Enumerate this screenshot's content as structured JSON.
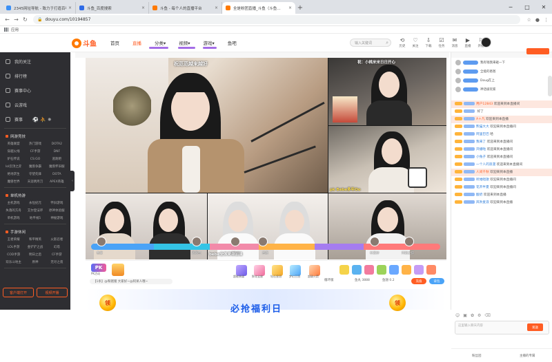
{
  "browser": {
    "tabs": [
      {
        "title": "2345网址导航 - 致力于打造百年品牌",
        "fav": "#3b8ff5",
        "active": false
      },
      {
        "title": "斗鱼_百度搜索",
        "fav": "#2f6be6",
        "active": false
      },
      {
        "title": "斗鱼 - 每个人的直播平台",
        "fav": "#ff7a00",
        "active": false
      },
      {
        "title": "全是粉团直播_斗鱼（斗鱼…",
        "fav": "#ff7a00",
        "active": true
      }
    ],
    "url": "douyu.com/10194857",
    "bookmarks_label": "应用",
    "new_tab_symbol": "+"
  },
  "site": {
    "logo": "斗鱼",
    "nav": [
      {
        "label": "首页",
        "active": false
      },
      {
        "label": "直播",
        "active": true
      },
      {
        "label": "分类▾",
        "active": false
      },
      {
        "label": "视频▾",
        "active": false
      },
      {
        "label": "游戏▾",
        "active": false
      },
      {
        "label": "鱼吧",
        "active": false
      }
    ],
    "search_placeholder": "输入关键词",
    "top_icons": [
      "历史",
      "关注",
      "下载",
      "任务",
      "消息",
      "直播",
      "开播"
    ]
  },
  "sidebar": {
    "items": [
      "我的关注",
      "排行榜",
      "赛事中心",
      "云游戏"
    ],
    "featured": "赛事",
    "sections": [
      {
        "title": "网游竞技",
        "items": [
          "英雄联盟",
          "热门游戏",
          "DOTA2",
          "穿越火线",
          "CF手游",
          "DNF",
          "炉石传说",
          "CS:GO",
          "逃跑吧",
          "lol云顶之弈",
          "魔兽争霸",
          "魔兽怀旧服",
          "绝地求生",
          "守望先锋",
          "DOTA",
          "魔兽世界",
          "天涯明月刀",
          "APEX英雄"
        ]
      },
      {
        "title": "单机热游",
        "items": [
          "主机游戏",
          "永恒纪元",
          "怀旧游戏",
          "失落的方舟",
          "艾尔登法环",
          "原神体验服",
          "单机游戏",
          "地平线5",
          "神秘游戏"
        ]
      },
      {
        "title": "手游休闲",
        "items": [
          "王者荣耀",
          "和平精英",
          "火影忍者",
          "LOL手游",
          "金铲铲之战",
          "幻塔",
          "COD手游",
          "明日之后",
          "CF手游",
          "欢乐斗地主",
          "原神",
          "无尽之夜"
        ]
      }
    ],
    "buttons": [
      "客户端打开",
      "视频开播"
    ]
  },
  "stream": {
    "captions": [
      "祝范范越来越好",
      "祝：小桃米米日日开心",
      "bebe全体来得加油",
      "pk Bebe多年Oo"
    ],
    "pk_names": [
      "我爱",
      "思思宝",
      "小骆驼",
      "团宠",
      "林思婷",
      "阿斑女孩"
    ],
    "pk_label": "PK",
    "pk_sub": "PK活动"
  },
  "toolbar": {
    "line_text": "【1条】@和猪猪 大家好~@阿呆人哦~",
    "gifts": [
      "超能装逼",
      "鲜花宝座",
      "钻石皇冠",
      "梦幻王冠",
      "超级火箭"
    ],
    "stats": [
      "循环版",
      "鱼丸 3888",
      "鱼翅 0.2"
    ],
    "buttons": [
      "充值",
      "背包"
    ]
  },
  "banner": {
    "title": "必抢福利日",
    "coin": "领"
  },
  "chat": {
    "rank": [
      "我有钱我来砸一下",
      "全能的爸爸",
      "Doug在上",
      "神话级玩家"
    ],
    "messages": [
      {
        "lvl": true,
        "name": "用户12843",
        "text": "欢迎来到本直播间",
        "hl": true
      },
      {
        "lvl": true,
        "name": "",
        "text": "好了",
        "hl": false
      },
      {
        "lvl": true,
        "name": "A＋凡",
        "text": "欢迎来到本直播",
        "hl": true
      },
      {
        "lvl": true,
        "name": "熊猫大大",
        "text": "欢迎来到本直播间",
        "hl": false
      },
      {
        "lvl": true,
        "name": "阿里巴巴",
        "text": "哈",
        "hl": false
      },
      {
        "lvl": true,
        "name": "我来了",
        "text": "欢迎来到本直播间",
        "hl": false
      },
      {
        "lvl": true,
        "name": "开播啦",
        "text": "欢迎来到本直播间",
        "hl": false
      },
      {
        "lvl": true,
        "name": "小兔子",
        "text": "欢迎来到本直播间",
        "hl": false
      },
      {
        "lvl": true,
        "name": "一个人的浪漫",
        "text": "欢迎来到本直播间",
        "hl": false
      },
      {
        "lvl": true,
        "name": "人间千秋",
        "text": "欢迎来到本直播",
        "hl": true
      },
      {
        "lvl": true,
        "name": "听她唱歌",
        "text": "欢迎来到本直播间",
        "hl": false
      },
      {
        "lvl": true,
        "name": "花开半夏",
        "text": "欢迎来到本直播间",
        "hl": false
      },
      {
        "lvl": true,
        "name": "酸奶",
        "text": "欢迎来到本直播",
        "hl": false
      },
      {
        "lvl": true,
        "name": "风吹麦浪",
        "text": "欢迎来到本直播",
        "hl": false
      }
    ],
    "input_placeholder": "这里输入聊天内容",
    "send": "发送",
    "footer": [
      "粉丝团",
      "主播的专属"
    ]
  }
}
